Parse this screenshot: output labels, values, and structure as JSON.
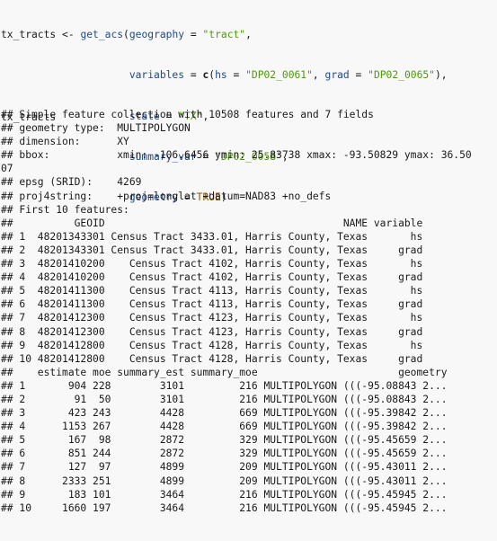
{
  "code": {
    "assign_var": "tx_tracts",
    "assign_op": " <- ",
    "function_name": "get_acs",
    "args": [
      {
        "name": "geography",
        "value": "\"tract\""
      },
      {
        "name": "variables",
        "c_fn": "c",
        "c_args": [
          {
            "name": "hs",
            "value": "\"DP02_0061\""
          },
          {
            "name": "grad",
            "value": "\"DP02_0065\""
          }
        ]
      },
      {
        "name": "state",
        "value": "\"TX\""
      },
      {
        "name": "summary_var",
        "value": "\"DP02_0058\""
      },
      {
        "name": "geometry",
        "value": "TRUE"
      }
    ]
  },
  "echo": "tx_tracts",
  "output_lines": [
    "## Simple feature collection with 10508 features and 7 fields",
    "## geometry type:  MULTIPOLYGON",
    "## dimension:      XY",
    "## bbox:           xmin: -106.6456 ymin: 25.83738 xmax: -93.50829 ymax: 36.50",
    "07",
    "## epsg (SRID):    4269",
    "## proj4string:    +proj=longlat +datum=NAD83 +no_defs",
    "## First 10 features:",
    "##          GEOID                                       NAME variable",
    "## 1  48201343301 Census Tract 3433.01, Harris County, Texas       hs",
    "## 2  48201343301 Census Tract 3433.01, Harris County, Texas     grad",
    "## 3  48201410200    Census Tract 4102, Harris County, Texas       hs",
    "## 4  48201410200    Census Tract 4102, Harris County, Texas     grad",
    "## 5  48201411300    Census Tract 4113, Harris County, Texas       hs",
    "## 6  48201411300    Census Tract 4113, Harris County, Texas     grad",
    "## 7  48201412300    Census Tract 4123, Harris County, Texas       hs",
    "## 8  48201412300    Census Tract 4123, Harris County, Texas     grad",
    "## 9  48201412800    Census Tract 4128, Harris County, Texas       hs",
    "## 10 48201412800    Census Tract 4128, Harris County, Texas     grad",
    "##    estimate moe summary_est summary_moe                       geometry",
    "## 1       904 228        3101         216 MULTIPOLYGON (((-95.08843 2...",
    "## 2        91  50        3101         216 MULTIPOLYGON (((-95.08843 2...",
    "## 3       423 243        4428         669 MULTIPOLYGON (((-95.39842 2...",
    "## 4      1153 267        4428         669 MULTIPOLYGON (((-95.39842 2...",
    "## 5       167  98        2872         329 MULTIPOLYGON (((-95.45659 2...",
    "## 6       851 244        2872         329 MULTIPOLYGON (((-95.45659 2...",
    "## 7       127  97        4899         209 MULTIPOLYGON (((-95.43011 2...",
    "## 8      2333 251        4899         209 MULTIPOLYGON (((-95.43011 2...",
    "## 9       183 101        3464         216 MULTIPOLYGON (((-95.45945 2...",
    "## 10     1660 197        3464         216 MULTIPOLYGON (((-95.45945 2..."
  ],
  "tokens": {
    "eq": " = ",
    "open_paren": "(",
    "close_paren": ")",
    "comma": ",",
    "comma_sp": ", ",
    "indent": "                     "
  },
  "colors": {
    "background": "#f8f8f8",
    "text": "#1a1a1a",
    "function": "#214a87",
    "string": "#4d9a06",
    "keyword": "#8f5902"
  }
}
